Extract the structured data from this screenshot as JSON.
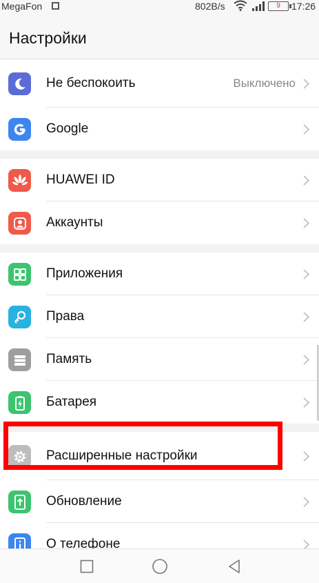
{
  "status_bar": {
    "carrier": "MegaFon",
    "speed": "802B/s",
    "battery": "9",
    "time": "17:26"
  },
  "header": {
    "title": "Настройки"
  },
  "groups": [
    {
      "items": [
        {
          "label": "Не беспокоить",
          "value": "Выключено",
          "icon": "moon-icon",
          "color": "#5b6bd8"
        },
        {
          "label": "Google",
          "icon": "google-icon",
          "color": "#3d86f0"
        }
      ]
    },
    {
      "items": [
        {
          "label": "HUAWEI ID",
          "icon": "huawei-icon",
          "color": "#ef5a4a"
        },
        {
          "label": "Аккаунты",
          "icon": "account-icon",
          "color": "#ef5a4a"
        }
      ]
    },
    {
      "items": [
        {
          "label": "Приложения",
          "icon": "apps-icon",
          "color": "#3cc46e"
        },
        {
          "label": "Права",
          "icon": "key-icon",
          "color": "#27b3e0"
        },
        {
          "label": "Память",
          "icon": "storage-icon",
          "color": "#9e9e9e"
        },
        {
          "label": "Батарея",
          "icon": "battery-icon",
          "color": "#3cc46e"
        }
      ]
    },
    {
      "items": [
        {
          "label": "Расширенные настройки",
          "icon": "gear-icon",
          "color": "#9e9e9e"
        },
        {
          "label": "Обновление",
          "icon": "update-icon",
          "color": "#3cc46e"
        },
        {
          "label": "О телефоне",
          "icon": "info-icon",
          "color": "#3d86f0"
        }
      ]
    }
  ],
  "highlight_color": "#ff0000"
}
